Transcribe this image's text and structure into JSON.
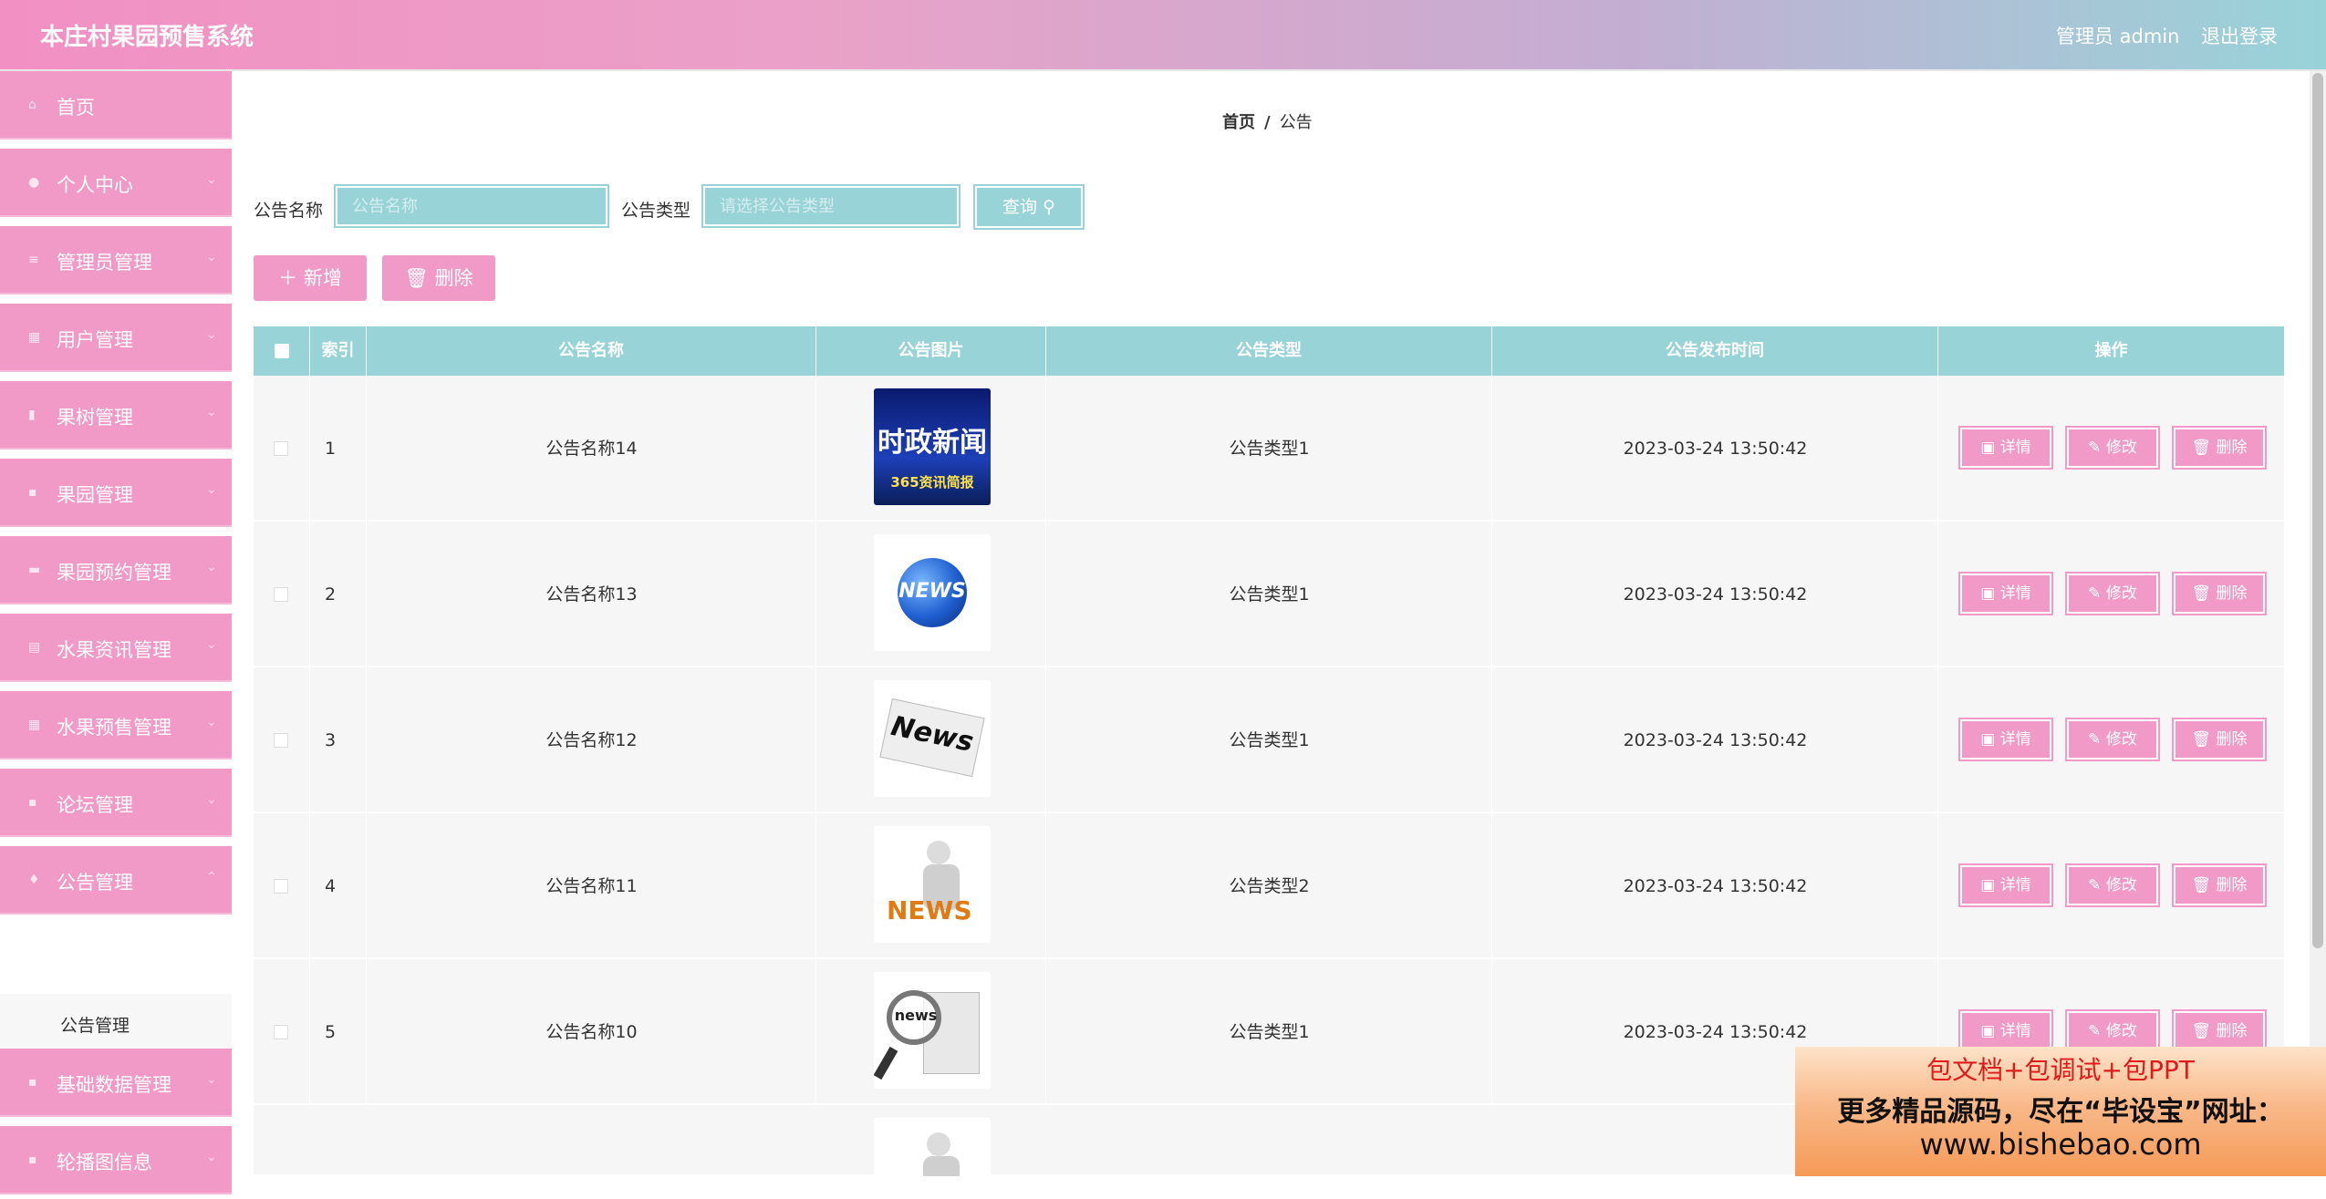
{
  "header": {
    "title": "本庄村果园预售系统",
    "user": "管理员 admin",
    "logout": "退出登录"
  },
  "sidebar": {
    "items": [
      {
        "label": "首页",
        "icon": "home-icon"
      },
      {
        "label": "个人中心",
        "icon": "user-icon"
      },
      {
        "label": "管理员管理",
        "icon": "list-icon"
      },
      {
        "label": "用户管理",
        "icon": "grid-icon"
      },
      {
        "label": "果树管理",
        "icon": "bar-chart-icon"
      },
      {
        "label": "果园管理",
        "icon": "apps-icon"
      },
      {
        "label": "果园预约管理",
        "icon": "monitor-icon"
      },
      {
        "label": "水果资讯管理",
        "icon": "table-icon"
      },
      {
        "label": "水果预售管理",
        "icon": "grid-icon"
      },
      {
        "label": "论坛管理",
        "icon": "apps-icon"
      },
      {
        "label": "公告管理",
        "icon": "trophy-icon"
      },
      {
        "label": "基础数据管理",
        "icon": "apps-icon"
      },
      {
        "label": "轮播图信息",
        "icon": "apps-icon"
      }
    ],
    "active_sub": "公告管理"
  },
  "breadcrumb": {
    "home": "首页",
    "sep": "/",
    "current": "公告"
  },
  "search": {
    "name_label": "公告名称",
    "name_placeholder": "公告名称",
    "type_label": "公告类型",
    "type_placeholder": "请选择公告类型",
    "button": "查询"
  },
  "actions": {
    "add": "新增",
    "delete": "删除"
  },
  "table": {
    "headers": [
      "索引",
      "公告名称",
      "公告图片",
      "公告类型",
      "公告发布时间",
      "操作"
    ],
    "rows": [
      {
        "index": "1",
        "name": "公告名称14",
        "type": "公告类型1",
        "time": "2023-03-24 13:50:42",
        "img_text": "时政新闻",
        "img_sub": "365资讯简报"
      },
      {
        "index": "2",
        "name": "公告名称13",
        "type": "公告类型1",
        "time": "2023-03-24 13:50:42",
        "img_text": "NEWS"
      },
      {
        "index": "3",
        "name": "公告名称12",
        "type": "公告类型1",
        "time": "2023-03-24 13:50:42",
        "img_text": "News"
      },
      {
        "index": "4",
        "name": "公告名称11",
        "type": "公告类型2",
        "time": "2023-03-24 13:50:42",
        "img_text": "NEWS"
      },
      {
        "index": "5",
        "name": "公告名称10",
        "type": "公告类型1",
        "time": "2023-03-24 13:50:42",
        "img_text": "news"
      }
    ],
    "ops": {
      "detail": "详情",
      "edit": "修改",
      "delete": "删除"
    }
  },
  "ad": {
    "line1": "包文档+包调试+包PPT",
    "line2": "更多精品源码，尽在“毕设宝”网址：",
    "line3": "www.bishebao.com"
  }
}
